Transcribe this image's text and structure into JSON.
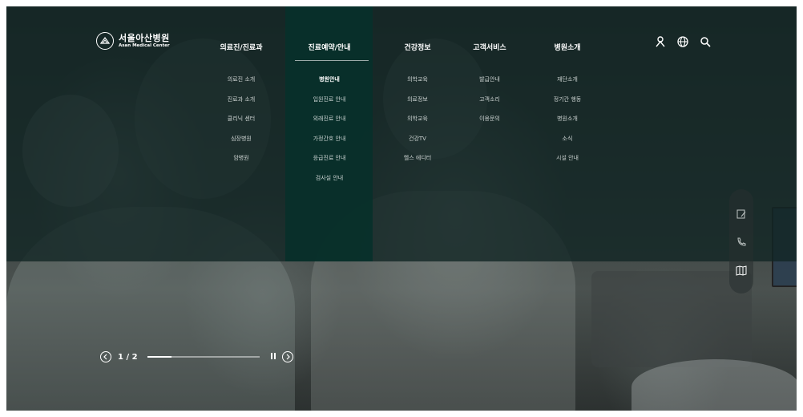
{
  "logo": {
    "name": "서울아산병원",
    "sub": "Asan Medical Center"
  },
  "nav": [
    {
      "label": "의료진/진료과",
      "items": [
        "의료진 소개",
        "진료과 소개",
        "클리닉 센터",
        "심장병원",
        "암병원"
      ]
    },
    {
      "label": "진료예약/안내",
      "items": [
        "병원안내",
        "입원진료 안내",
        "외래진료 안내",
        "가정간호 안내",
        "응급진료 안내",
        "검사실 안내"
      ],
      "current_item": "병원안내"
    },
    {
      "label": "건강정보",
      "items": [
        "의학교육",
        "의료정보",
        "의학교육",
        "건강TV",
        "헬스 에디터"
      ]
    },
    {
      "label": "고객서비스",
      "items": [
        "발급안내",
        "고객소리",
        "이용문의"
      ]
    },
    {
      "label": "병원소개",
      "items": [
        "재단소개",
        "정기간 행동",
        "병원소개",
        "소식",
        "시설 안내"
      ]
    }
  ],
  "utility_icons": [
    "user-icon",
    "globe-icon",
    "search-icon"
  ],
  "quick_menu_icons": [
    "reservation-icon",
    "phone-icon",
    "map-icon"
  ],
  "slider": {
    "counter": "1 / 2",
    "progress": 0.22
  },
  "colors": {
    "menu_overlay": "#12261f",
    "active_column": "#08302a",
    "text": "#ffffff"
  }
}
